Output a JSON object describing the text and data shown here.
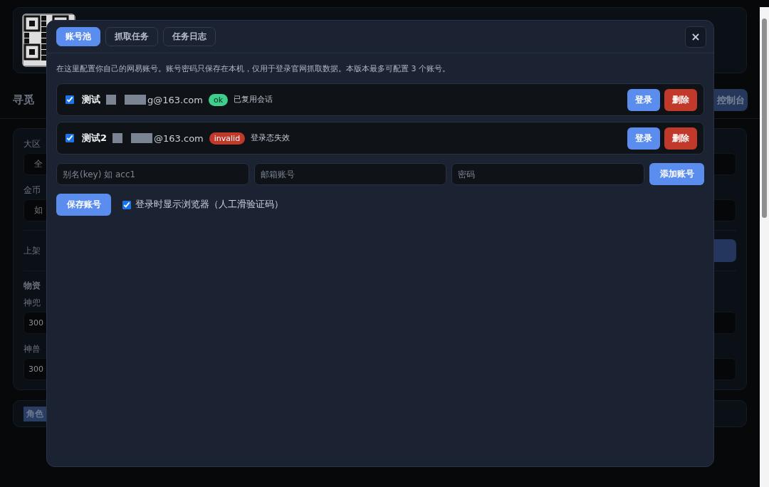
{
  "background": {
    "heading": "寻觅",
    "console_button": "控制台",
    "fields": [
      {
        "label": "大区",
        "value": "全"
      },
      {
        "label": "金币",
        "placeholder": "如"
      }
    ],
    "status_label": "上架",
    "section_title": "物资",
    "items": [
      {
        "label": "神兜",
        "value": "300"
      },
      {
        "label": "神兽",
        "value": "300"
      }
    ],
    "role_tag": "角色"
  },
  "dialog": {
    "tabs": [
      {
        "label": "账号池",
        "selected": true
      },
      {
        "label": "抓取任务",
        "selected": false
      },
      {
        "label": "任务日志",
        "selected": false
      }
    ],
    "close": "×",
    "intro": "在这里配置你自己的网易账号。账号密码只保存在本机，仅用于登录官网抓取数据。本版本最多可配置 3 个账号。",
    "accounts": [
      {
        "checked": true,
        "name": "测试",
        "email": "g@163.com",
        "status": "ok",
        "color": "#3ecf8e",
        "note": "已复用会话",
        "login": "登录",
        "delete": "删除"
      },
      {
        "checked": true,
        "name": "测试2",
        "email": "@163.com",
        "status": "invalid",
        "color": "#c0392b",
        "note": "登录态失效",
        "login": "登录",
        "delete": "删除"
      }
    ],
    "new_account": {
      "alias_placeholder": "别名(key) 如 acc1",
      "email_placeholder": "邮箱账号",
      "password_placeholder": "密码",
      "add_button": "添加账号"
    },
    "save_button": "保存账号",
    "show_browser": {
      "checked": true,
      "label": "登录时显示浏览器（人工滑验证码）"
    }
  }
}
